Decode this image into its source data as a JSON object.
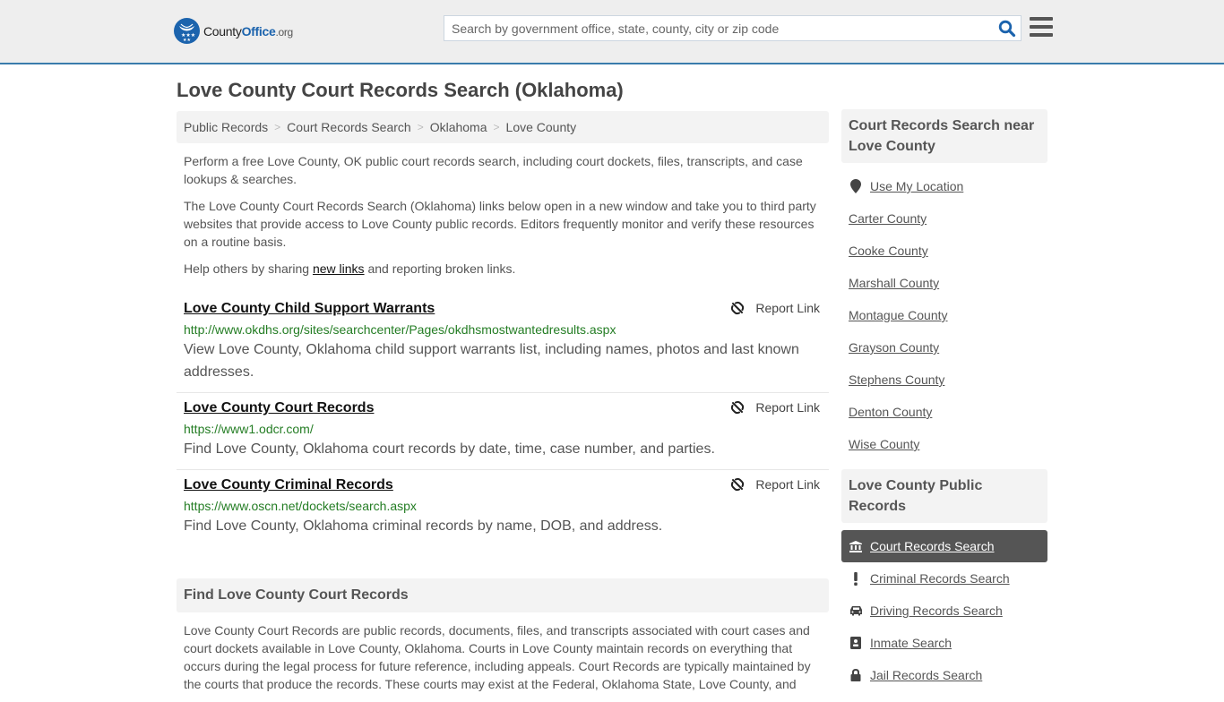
{
  "header": {
    "logo": {
      "county": "County",
      "office": "Office",
      "org": ".org"
    },
    "search_placeholder": "Search by government office, state, county, city or zip code",
    "search_value": ""
  },
  "page_title": "Love County Court Records Search (Oklahoma)",
  "breadcrumb": [
    "Public Records",
    "Court Records Search",
    "Oklahoma",
    "Love County"
  ],
  "intro": {
    "p1": "Perform a free Love County, OK public court records search, including court dockets, files, transcripts, and case lookups & searches.",
    "p2": "The Love County Court Records Search (Oklahoma) links below open in a new window and take you to third party websites that provide access to Love County public records. Editors frequently monitor and verify these resources on a routine basis.",
    "p3_before": "Help others by sharing ",
    "p3_link": "new links",
    "p3_after": " and reporting broken links."
  },
  "report_label": "Report Link",
  "results": [
    {
      "title": "Love County Child Support Warrants",
      "url": "http://www.okdhs.org/sites/searchcenter/Pages/okdhsmostwantedresults.aspx",
      "description": "View Love County, Oklahoma child support warrants list, including names, photos and last known addresses."
    },
    {
      "title": "Love County Court Records",
      "url": "https://www1.odcr.com/",
      "description": "Find Love County, Oklahoma court records by date, time, case number, and parties."
    },
    {
      "title": "Love County Criminal Records",
      "url": "https://www.oscn.net/dockets/search.aspx",
      "description": "Find Love County, Oklahoma criminal records by name, DOB, and address."
    }
  ],
  "find_section": {
    "heading": "Find Love County Court Records",
    "body": "Love County Court Records are public records, documents, files, and transcripts associated with court cases and court dockets available in Love County, Oklahoma. Courts in Love County maintain records on everything that occurs during the legal process for future reference, including appeals. Court Records are typically maintained by the courts that produce the records. These courts may exist at the Federal, Oklahoma State, Love County, and"
  },
  "sidebar": {
    "nearby_heading": "Court Records Search near Love County",
    "use_location": "Use My Location",
    "nearby": [
      "Carter County",
      "Cooke County",
      "Marshall County",
      "Montague County",
      "Grayson County",
      "Stephens County",
      "Denton County",
      "Wise County"
    ],
    "public_heading": "Love County Public Records",
    "public_records": [
      {
        "label": "Court Records Search",
        "icon": "courthouse-icon",
        "active": true
      },
      {
        "label": "Criminal Records Search",
        "icon": "exclamation-icon",
        "active": false
      },
      {
        "label": "Driving Records Search",
        "icon": "car-icon",
        "active": false
      },
      {
        "label": "Inmate Search",
        "icon": "id-card-icon",
        "active": false
      },
      {
        "label": "Jail Records Search",
        "icon": "lock-icon",
        "active": false
      }
    ]
  },
  "colors": {
    "brand_blue": "#1b63ad",
    "header_border": "#3a7cac",
    "url_green": "#247d24",
    "active_item_bg": "#555555"
  }
}
